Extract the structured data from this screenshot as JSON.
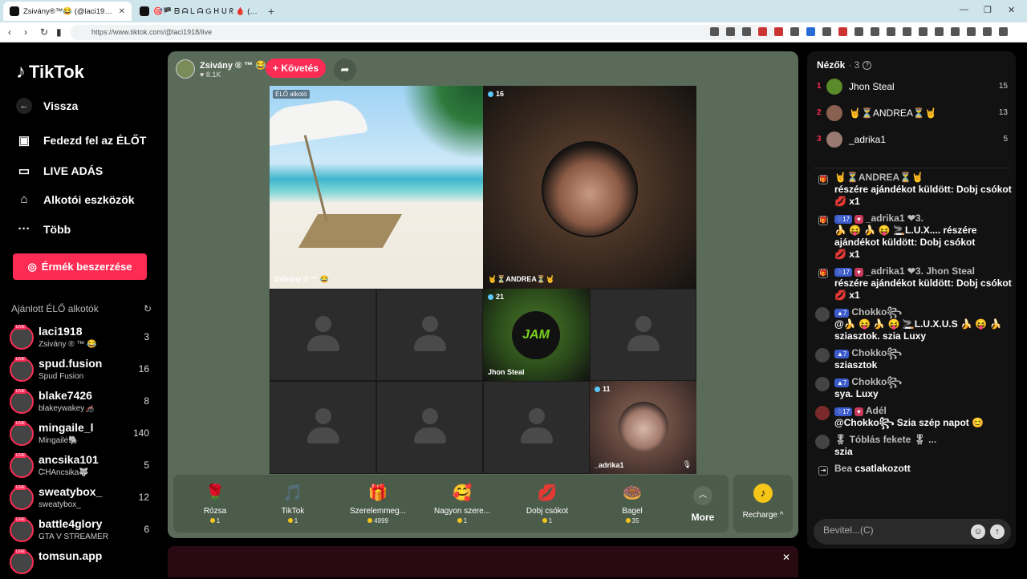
{
  "browser": {
    "tabs": [
      {
        "label": "Zsivány®™😂 (@laci1918) É..."
      },
      {
        "label": "🎯🏴 ᗷ ᗩ ᒪ ᗩ G ᕼ ᑌ ᖇ 🩸 (@gabo..."
      }
    ],
    "new_tab": "+",
    "url": "https://www.tiktok.com/@laci1918/live"
  },
  "sidebar": {
    "logo": "TikTok",
    "nav": [
      {
        "label": "Vissza",
        "icon": "back-arrow-icon"
      },
      {
        "label": "Fedezd fel az ÉLŐT",
        "icon": "tv-icon"
      },
      {
        "label": "LIVE ADÁS",
        "icon": "camera-icon"
      },
      {
        "label": "Alkotói eszközök",
        "icon": "lightbulb-icon"
      },
      {
        "label": "Több",
        "icon": "more-dots-icon"
      }
    ],
    "coins_button": "Érmék beszerzése",
    "recommended_title": "Ajánlott ÉLŐ alkotók",
    "live_badge": "LIVE",
    "recommended": [
      {
        "name": "laci1918",
        "sub": "Zsivány ® ™ 😂",
        "count": "3"
      },
      {
        "name": "spud.fusion",
        "sub": "Spud Fusion",
        "count": "16"
      },
      {
        "name": "blake7426",
        "sub": "blakeywakey🦽",
        "count": "8"
      },
      {
        "name": "mingaile_l",
        "sub": "Mingailė🐘",
        "count": "140"
      },
      {
        "name": "ancsika101",
        "sub": "ᏨᎻAncsika🐺",
        "count": "5"
      },
      {
        "name": "sweatybox_",
        "sub": "sweatybox_",
        "count": "12"
      },
      {
        "name": "battle4glory",
        "sub": "GTA V STREAMER",
        "count": "6"
      },
      {
        "name": "tomsun.app",
        "sub": "",
        "count": ""
      }
    ]
  },
  "stream": {
    "host_name": "Zsivány ® ™ 😂",
    "host_likes": "♥ 8.1K",
    "follow_label": "+ Követés",
    "cells": {
      "beach": {
        "badge": "ÉLŐ alkotó",
        "name": "Zsivány ® ™ 😂"
      },
      "andrea": {
        "viewers": "16",
        "name": "🤘⏳ANDREA⏳🤘"
      },
      "jhon": {
        "viewers": "21",
        "name": "Jhon Steal",
        "logo": "JAM"
      },
      "adrika": {
        "viewers": "11",
        "name": "_adrika1"
      }
    },
    "gifts": [
      {
        "name": "Rózsa",
        "price": "1",
        "icon": "🌹"
      },
      {
        "name": "TikTok",
        "price": "1",
        "icon": "🎵"
      },
      {
        "name": "Szerelemmeg...",
        "price": "4999",
        "icon": "🎁"
      },
      {
        "name": "Nagyon szere...",
        "price": "1",
        "icon": "🥰"
      },
      {
        "name": "Dobj csókot",
        "price": "1",
        "icon": "💋"
      },
      {
        "name": "Bagel",
        "price": "35",
        "icon": "🍩"
      }
    ],
    "more_label": "More",
    "recharge_label": "Recharge ^"
  },
  "panel": {
    "viewers_title": "Nézők",
    "viewers_count": "· 3",
    "top_viewers": [
      {
        "rank": "1",
        "name": "Jhon Steal",
        "score": "15"
      },
      {
        "rank": "2",
        "name": "🤘⏳ANDREA⏳🤘",
        "score": "13"
      },
      {
        "rank": "3",
        "name": "_adrika1",
        "score": "5"
      }
    ],
    "chat": [
      {
        "type": "gift",
        "level": "",
        "fan": "",
        "user": "🤘⏳ANDREA⏳🤘",
        "text": "részére ajándékot küldött: Dobj csókot",
        "extra": "💋 x1"
      },
      {
        "type": "gift",
        "level": "♢17",
        "fan": "♥",
        "user": "_adrika1  ❤3.",
        "text": "🍌 😝 🍌 😝 🚬L.U.X.... részére ajándékot küldött: Dobj csókot",
        "extra": "💋 x1"
      },
      {
        "type": "gift",
        "level": "♢17",
        "fan": "♥",
        "user": "_adrika1  ❤3.  Jhon Steal",
        "text": "részére ajándékot küldött: Dobj csókot",
        "extra": "💋 x1"
      },
      {
        "type": "msg",
        "level": "▲7",
        "fan": "",
        "user": "Chokko꧂",
        "text": "@🍌 😝 🍌 😝 🚬L.U.X.U.S 🍌 😝 🍌 sziasztok. szia Luxy",
        "extra": ""
      },
      {
        "type": "msg",
        "level": "▲7",
        "fan": "",
        "user": "Chokko꧂",
        "text": "sziasztok",
        "extra": ""
      },
      {
        "type": "msg",
        "level": "▲7",
        "fan": "",
        "user": "Chokko꧂",
        "text": "sya. Luxy",
        "extra": ""
      },
      {
        "type": "msg",
        "level": "♢17",
        "fan": "♥",
        "user": "Adél",
        "text": "@Chokko꧂ Szia szép napot 😊",
        "extra": ""
      },
      {
        "type": "msg",
        "level": "",
        "fan": "",
        "user": "🎖 Tóblás fekete 🎖 ...",
        "text": "szia",
        "extra": ""
      },
      {
        "type": "join",
        "level": "",
        "fan": "",
        "user": "Bea",
        "text": "csatlakozott",
        "extra": ""
      }
    ],
    "input_placeholder": "Bevitel...(C)"
  }
}
